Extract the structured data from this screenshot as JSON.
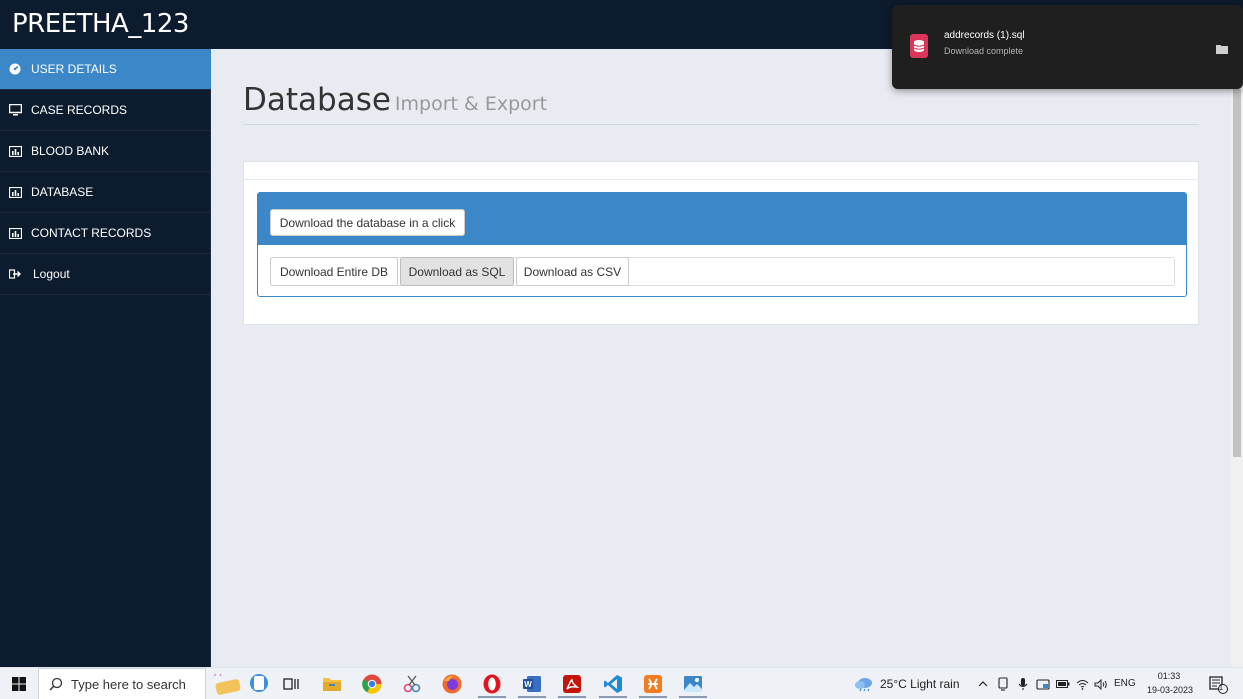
{
  "app": {
    "brand": "PREETHA_123"
  },
  "sidebar": {
    "items": [
      {
        "label": "USER DETAILS",
        "icon": "dashboard-icon",
        "active": true
      },
      {
        "label": "CASE RECORDS",
        "icon": "monitor-icon"
      },
      {
        "label": "BLOOD BANK",
        "icon": "bar-chart-icon"
      },
      {
        "label": "DATABASE",
        "icon": "bar-chart-icon"
      },
      {
        "label": "CONTACT RECORDS",
        "icon": "bar-chart-icon"
      },
      {
        "label": "Logout",
        "icon": "logout-icon"
      }
    ]
  },
  "page": {
    "title": "Database",
    "subtitle": "Import & Export"
  },
  "panel": {
    "primary_button": "Download the database in a click",
    "buttons": [
      "Download Entire DB",
      "Download as SQL",
      "Download as CSV"
    ]
  },
  "download": {
    "filename": "addrecords (1).sql",
    "status": "Download complete",
    "file_icon": "database-file-icon",
    "folder_icon": "folder-icon"
  },
  "taskbar": {
    "search_placeholder": "Type here to search",
    "weather": "25°C  Light rain",
    "language": "ENG",
    "time": "01:33",
    "date": "19-03-2023",
    "notification_count": "1"
  },
  "colors": {
    "navbar": "#0d1b2e",
    "accent": "#3b87c8",
    "background": "#e8ecf2"
  }
}
